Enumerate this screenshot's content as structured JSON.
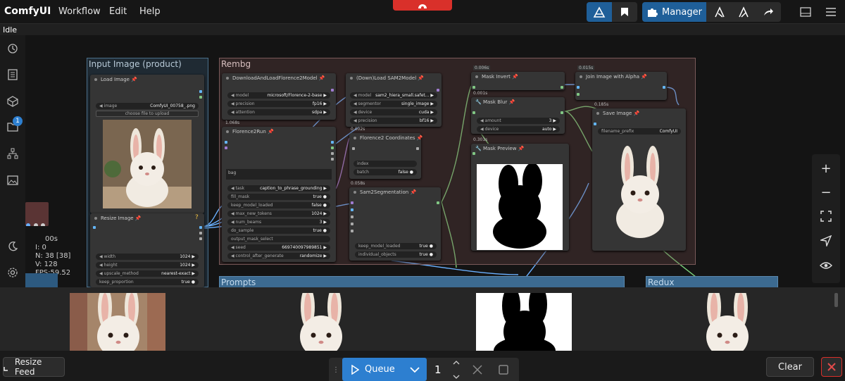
{
  "app": {
    "title": "ComfyUI",
    "status": "Idle"
  },
  "menu": {
    "workflow": "Workflow",
    "edit": "Edit",
    "help": "Help"
  },
  "toolbar": {
    "manager_label": "Manager",
    "blue": "#1f5f99"
  },
  "sidebar": {
    "queue_badge": "1"
  },
  "groups": {
    "input": "Input Image (product)",
    "rembg": "Rembg",
    "prompts": "Prompts",
    "redux": "Redux"
  },
  "nodes": {
    "load_image": {
      "title": "Load Image",
      "image_label": "image",
      "image_value": "ComfyUI_00758_.png",
      "upload": "choose file to upload"
    },
    "resize_image": {
      "title": "Resize Image",
      "help": "?",
      "widgets": [
        {
          "name": "width",
          "value": "1024"
        },
        {
          "name": "height",
          "value": "1024"
        },
        {
          "name": "upscale_method",
          "value": "nearest-exact"
        },
        {
          "name": "keep_proportion",
          "value": "true"
        }
      ]
    },
    "download_florence": {
      "title": "DownloadAndLoadFlorence2Model",
      "widgets": [
        {
          "name": "model",
          "value": "microsoft/Florence-2-base"
        },
        {
          "name": "precision",
          "value": "fp16"
        },
        {
          "name": "attention",
          "value": "sdpa"
        }
      ]
    },
    "florence_run": {
      "title": "Florence2Run",
      "time": "1.068s",
      "text_label": "bag",
      "widgets": [
        {
          "name": "task",
          "value": "caption_to_phrase_grounding"
        },
        {
          "name": "fill_mask",
          "value": "true"
        },
        {
          "name": "keep_model_loaded",
          "value": "false"
        },
        {
          "name": "max_new_tokens",
          "value": "1024"
        },
        {
          "name": "num_beams",
          "value": "3"
        },
        {
          "name": "do_sample",
          "value": "true"
        },
        {
          "name": "output_mask_select",
          "value": ""
        },
        {
          "name": "seed",
          "value": "669740097989851"
        },
        {
          "name": "control_after_generate",
          "value": "randomize"
        }
      ]
    },
    "sam2_model": {
      "title": "(Down)Load SAM2Model",
      "widgets": [
        {
          "name": "model",
          "value": "sam2_hiera_small.safet..."
        },
        {
          "name": "segmentor",
          "value": "single_image"
        },
        {
          "name": "device",
          "value": "cuda"
        },
        {
          "name": "precision",
          "value": "bf16"
        }
      ]
    },
    "florence_coords": {
      "title": "Florence2 Coordinates",
      "time": "0.002s",
      "widgets": [
        {
          "name": "index",
          "value": ""
        },
        {
          "name": "batch",
          "value": "false"
        }
      ]
    },
    "sam2_seg": {
      "title": "Sam2Segmentation",
      "time": "0.058s",
      "widgets": [
        {
          "name": "keep_model_loaded",
          "value": "true"
        },
        {
          "name": "individual_objects",
          "value": "true"
        }
      ]
    },
    "mask_invert": {
      "title": "Mask Invert",
      "time_top": "0.006s",
      "time": "0.001s"
    },
    "mask_blur": {
      "title": "Mask Blur",
      "widgets": [
        {
          "name": "amount",
          "value": "3"
        },
        {
          "name": "device",
          "value": "auto"
        }
      ]
    },
    "mask_preview": {
      "title": "Mask Preview",
      "time": "0.301s"
    },
    "join_alpha": {
      "title": "Join Image with Alpha",
      "time_top": "0.015s"
    },
    "save_image": {
      "title": "Save Image",
      "time": "0.185s",
      "prefix_label": "filename_prefix",
      "prefix_value": "ComfyUI"
    }
  },
  "overlay": {
    "time": "00s",
    "line1": "I: 0",
    "line2": "N: 38 [38]",
    "line3": "V: 128",
    "line4": "FPS:59.52"
  },
  "bottom": {
    "resize_feed": "Resize Feed",
    "queue": "Queue",
    "count": "1",
    "clear": "Clear"
  }
}
